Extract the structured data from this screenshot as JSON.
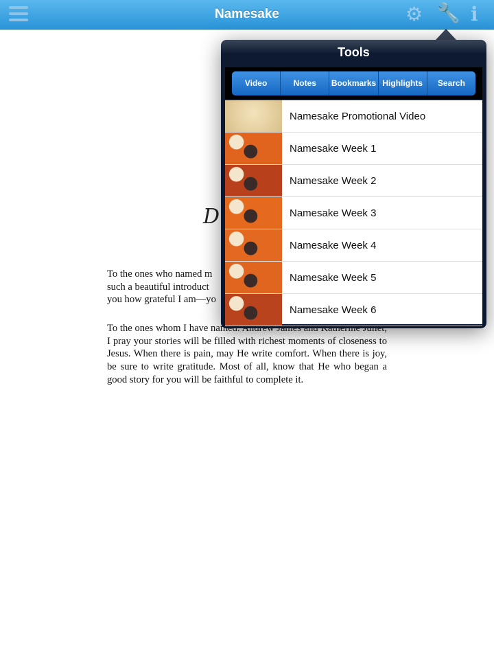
{
  "nav": {
    "title": "Namesake"
  },
  "page": {
    "heading_visible": "D",
    "paragraph1_lines": [
      "To the ones who named m",
      "such a beautiful introduct",
      "you how grateful I am—yo"
    ],
    "paragraph2": "To the ones whom I have named. Andrew James and Katherine Juliet, I pray your stories will be filled with richest moments of closeness to Jesus. When there is pain, may He write comfort. When there is joy, be sure to write gratitude. Most of all, know that He who began a good story for you will be faithful to complete it."
  },
  "tools": {
    "title": "Tools",
    "tabs": [
      "Video",
      "Notes",
      "Bookmarks",
      "Highlights",
      "Search"
    ],
    "videos": [
      {
        "title": "Namesake Promotional Video",
        "thumb_color": "#d9c08a"
      },
      {
        "title": "Namesake Week 1",
        "thumb_color": "#e0641e"
      },
      {
        "title": "Namesake Week 2",
        "thumb_color": "#b8401a"
      },
      {
        "title": "Namesake Week 3",
        "thumb_color": "#e56a1e"
      },
      {
        "title": "Namesake Week 4",
        "thumb_color": "#e36820"
      },
      {
        "title": "Namesake Week 5",
        "thumb_color": "#e0661f"
      },
      {
        "title": "Namesake Week 6",
        "thumb_color": "#b9431c"
      }
    ]
  }
}
